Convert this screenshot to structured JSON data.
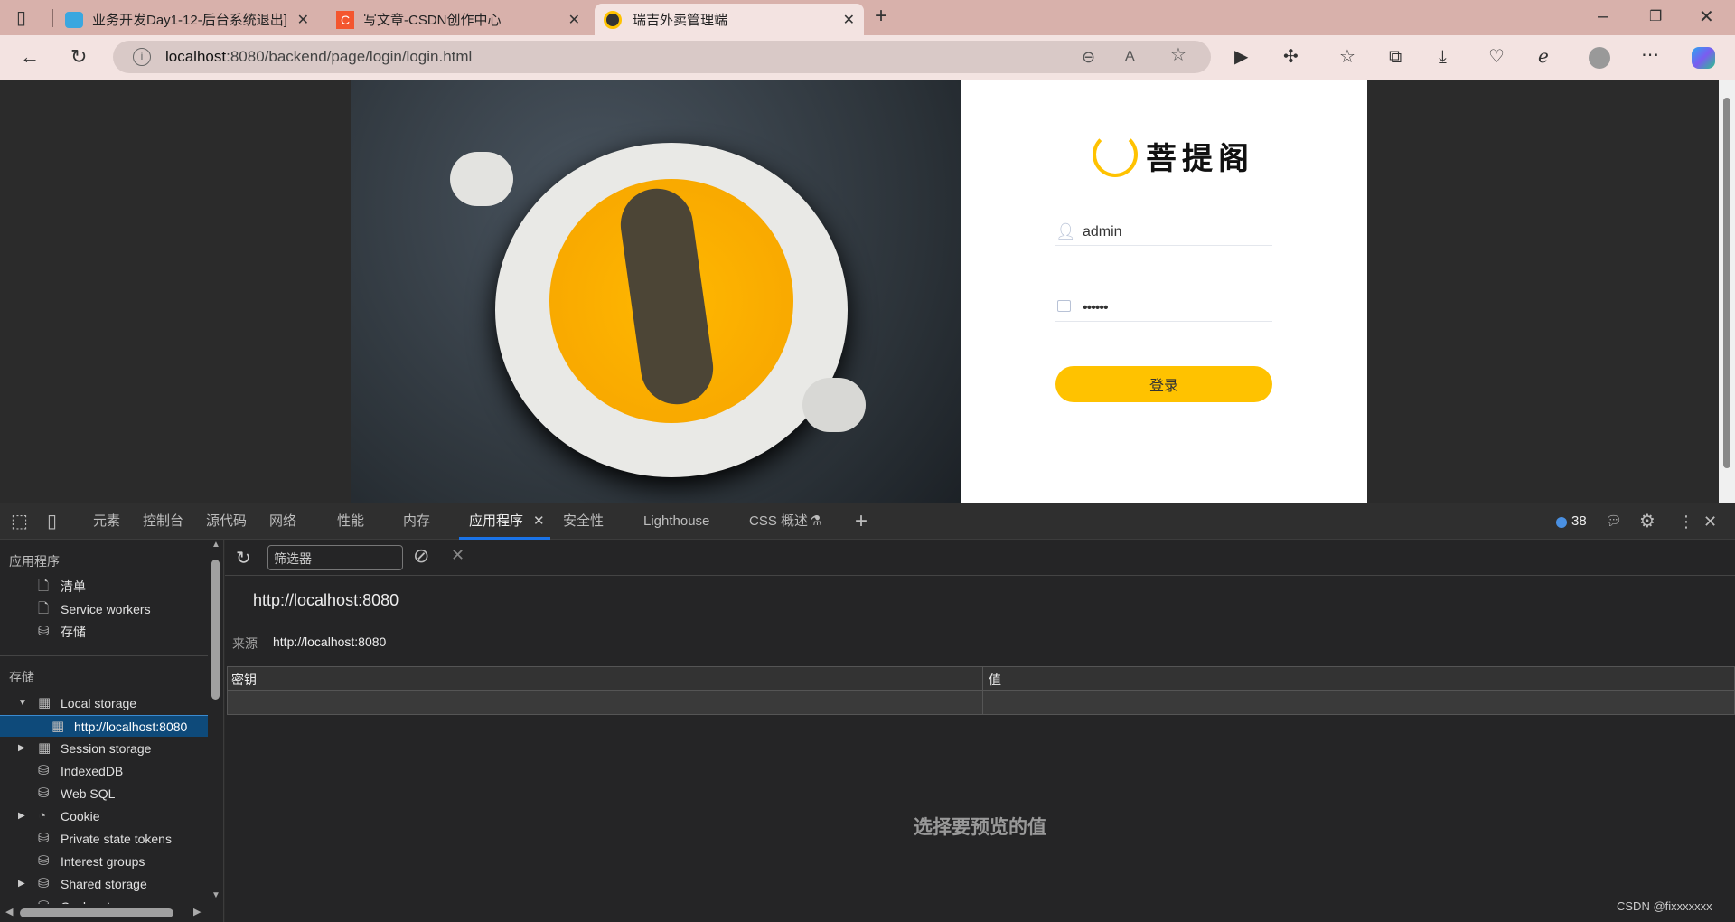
{
  "browser": {
    "tabs": [
      {
        "title": "业务开发Day1-12-后台系统退出]",
        "icon": "bilibili-icon"
      },
      {
        "title": "写文章-CSDN创作中心",
        "icon": "csdn-icon"
      },
      {
        "title": "瑞吉外卖管理端",
        "icon": "app-logo-icon",
        "active": true
      }
    ],
    "url_host": "localhost",
    "url_rest": ":8080/backend/page/login/login.html"
  },
  "login": {
    "brand": "菩提阁",
    "username": "admin",
    "password_mask": "••••••",
    "button": "登录",
    "accent": "#ffc200"
  },
  "devtools": {
    "tabs": [
      "元素",
      "控制台",
      "源代码",
      "网络",
      "性能",
      "内存",
      "应用程序",
      "安全性",
      "Lighthouse",
      "CSS 概述"
    ],
    "active_tab": "应用程序",
    "issues_count": "38",
    "sidebar": {
      "app_header": "应用程序",
      "app_items": [
        "清单",
        "Service workers",
        "存储"
      ],
      "storage_header": "存储",
      "storage_items": [
        {
          "label": "Local storage",
          "expanded": true
        },
        {
          "label": "http://localhost:8080",
          "selected": true
        },
        {
          "label": "Session storage"
        },
        {
          "label": "IndexedDB"
        },
        {
          "label": "Web SQL"
        },
        {
          "label": "Cookie"
        },
        {
          "label": "Private state tokens"
        },
        {
          "label": "Interest groups"
        },
        {
          "label": "Shared storage"
        },
        {
          "label": "Cache storage"
        }
      ]
    },
    "filter_placeholder": "筛选器",
    "origin_title": "http://localhost:8080",
    "origin_label": "来源",
    "origin_value": "http://localhost:8080",
    "columns": [
      "密钥",
      "值"
    ],
    "empty_message": "选择要预览的值"
  },
  "watermark": "CSDN @fixxxxxxx"
}
